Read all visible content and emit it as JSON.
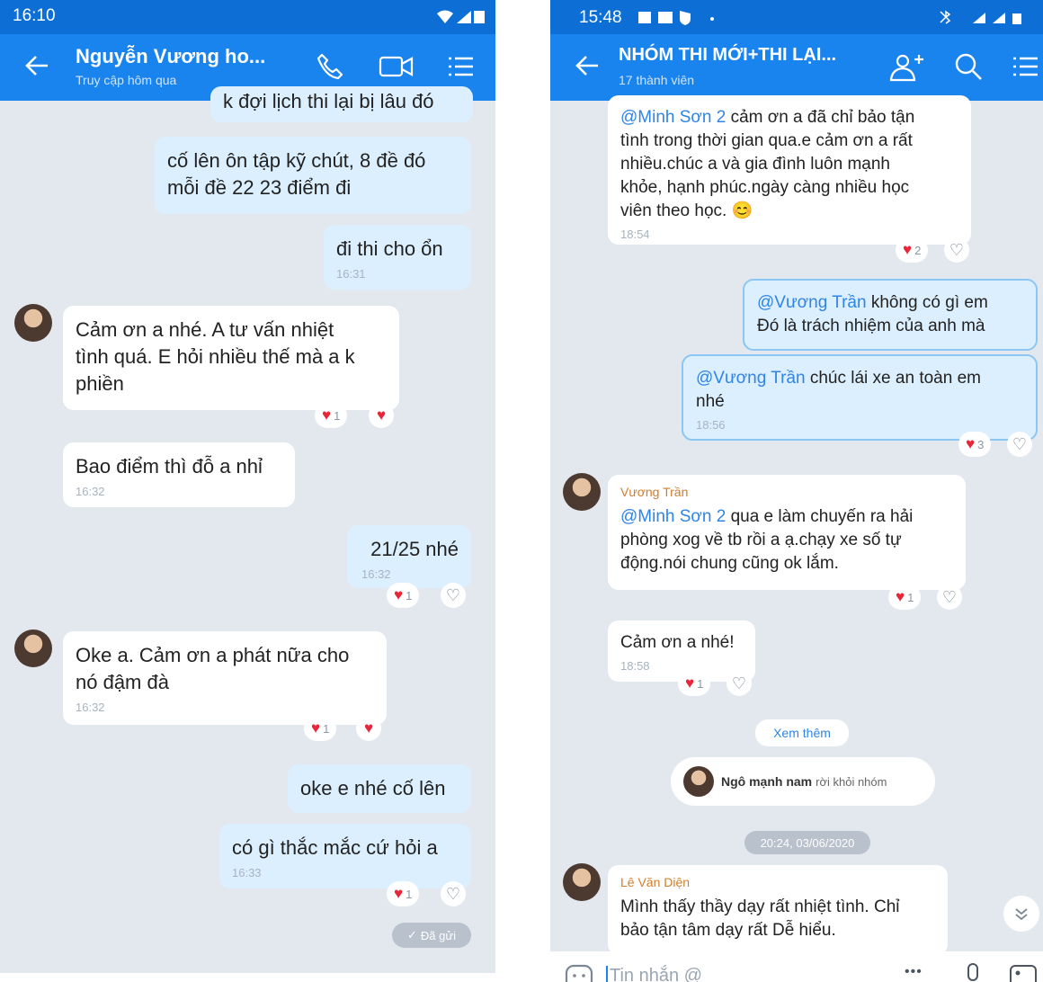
{
  "left": {
    "status": {
      "time": "16:10"
    },
    "header": {
      "title": "Nguyễn Vương ho...",
      "subtitle": "Truy cập hôm qua"
    },
    "messages": [
      {
        "text": "k đợi lịch thi lại bị lâu đó"
      },
      {
        "text": "cố lên ôn tập kỹ chút, 8 đề đó\nmỗi đề 22 23 điểm đi"
      },
      {
        "text": "đi thi cho ổn",
        "time": "16:31"
      },
      {
        "text": "Cảm ơn a nhé. A tư vấn nhiệt\ntình quá. E hỏi nhiều thế mà a k\nphiền",
        "reaction_count": "1"
      },
      {
        "text": "Bao điểm thì đỗ a nhỉ",
        "time": "16:32"
      },
      {
        "text": "21/25 nhé",
        "time": "16:32",
        "reaction_count": "1"
      },
      {
        "text": "Oke a. Cảm ơn a phát nữa cho\nnó đậm đà",
        "time": "16:32",
        "reaction_count": "1"
      },
      {
        "text": "oke e nhé cố lên"
      },
      {
        "text": "có gì thắc mắc cứ hỏi a",
        "time": "16:33",
        "reaction_count": "1"
      }
    ],
    "sent_label": "Đã gửi"
  },
  "right": {
    "status": {
      "time": "15:48"
    },
    "header": {
      "title": "NHÓM THI MỚI+THI LẠI...",
      "subtitle": "17 thành viên"
    },
    "messages": [
      {
        "mention": "@Minh Sơn 2",
        "text": " cảm ơn a đã chỉ bảo tận\ntình trong thời gian qua.e cảm ơn a  rất\nnhiều.chúc a và gia đình luôn mạnh\nkhỏe, hạnh phúc.ngày càng nhiều học\nviên theo học. 😊",
        "time": "18:54",
        "reaction_count": "2"
      },
      {
        "mention": "@Vương Trần",
        "text": " không có gì em\nĐó là trách nhiệm của anh mà"
      },
      {
        "mention": "@Vương Trần",
        "text": " chúc lái xe an toàn em\nnhé",
        "time": "18:56",
        "reaction_count": "3"
      },
      {
        "sender": "Vương Trần",
        "mention": "@Minh Sơn 2",
        "text": "  qua e làm chuyến ra hải\nphòng xog về tb rồi a ạ.chạy xe số tự\nđộng.nói chung cũng ok lắm.",
        "reaction_count": "1"
      },
      {
        "text": "Cảm ơn a nhé!",
        "time": "18:58",
        "reaction_count": "1"
      },
      {
        "sender": "Lê Văn Diện",
        "text": "Mình thấy thầy dạy rất nhiệt tình. Chỉ\nbảo tận tâm dạy rất Dễ hiểu."
      }
    ],
    "see_more": "Xem thêm",
    "system_name": "Ngô mạnh nam",
    "system_action": "rời khỏi nhóm",
    "date_divider": "20:24, 03/06/2020",
    "input_placeholder": "Tin nhắn @",
    "input_more": "•••"
  },
  "colors": {
    "header": "#1a84ee",
    "statusbar": "#0d6ed6",
    "chat_bg": "#e3e8ef",
    "my_bubble": "#dcefff",
    "their_bubble": "#ffffff",
    "mention": "#2f84e6",
    "sender": "#d27d2b",
    "heart": "#e8263a"
  },
  "icons": [
    "back-arrow-icon",
    "phone-icon",
    "video-call-icon",
    "menu-list-icon",
    "add-member-icon",
    "search-icon",
    "heart-icon",
    "heart-outline-icon",
    "check-icon",
    "chevron-down-icon",
    "emoji-icon",
    "mic-icon",
    "image-icon"
  ]
}
